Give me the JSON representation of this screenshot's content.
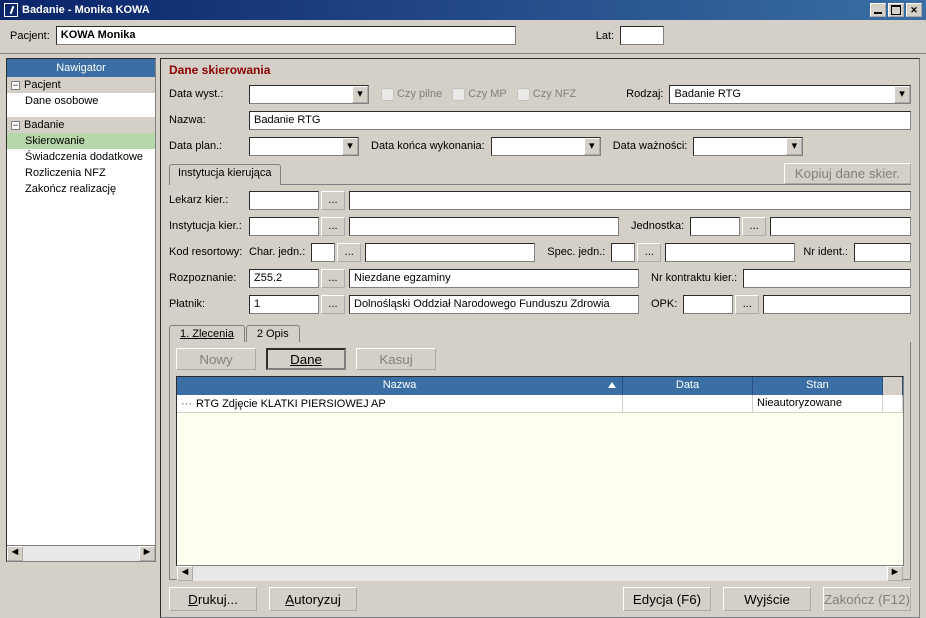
{
  "window": {
    "title": "Badanie - Monika KOWA"
  },
  "topbar": {
    "pacjent_label": "Pacjent:",
    "pacjent_value": "KOWA Monika",
    "lat_label": "Lat:",
    "lat_value": ""
  },
  "nav": {
    "header": "Nawigator",
    "pacjent": "Pacjent",
    "dane_osobowe": "Dane osobowe",
    "badanie": "Badanie",
    "skierowanie": "Skierowanie",
    "swiadczenia": "Świadczenia dodatkowe",
    "rozliczenia": "Rozliczenia NFZ",
    "zakoncz": "Zakończ realizację"
  },
  "section": {
    "title": "Dane skierowania"
  },
  "labels": {
    "data_wyst": "Data wyst.:",
    "czy_pilne": "Czy pilne",
    "czy_mp": "Czy MP",
    "czy_nfz": "Czy NFZ",
    "rodzaj": "Rodzaj:",
    "nazwa": "Nazwa:",
    "data_plan": "Data plan.:",
    "data_konca": "Data końca wykonania:",
    "data_waznosci": "Data ważności:",
    "instytucja_tab": "Instytucja kierująca",
    "kopiuj": "Kopiuj dane skier.",
    "lekarz": "Lekarz kier.:",
    "instytucja": "Instytucja kier.:",
    "jednostka": "Jednostka:",
    "kod_resortowy": "Kod resortowy:",
    "char_jedn": "Char. jedn.:",
    "spec_jedn": "Spec. jedn.:",
    "nr_ident": "Nr ident.:",
    "rozpoznanie": "Rozpoznanie:",
    "nr_kontraktu": "Nr kontraktu kier.:",
    "platnik": "Płatnik:",
    "opk": "OPK:"
  },
  "values": {
    "rodzaj": "Badanie RTG",
    "nazwa": "Badanie RTG",
    "rozpoznanie_kod": "Z55.2",
    "rozpoznanie_opis": "Niezdane egzaminy",
    "platnik_kod": "1",
    "platnik_opis": "Dolnośląski Oddział Narodowego Funduszu Zdrowia"
  },
  "tabs": {
    "zlecenia": "1. Zlecenia",
    "opis": "2 Opis"
  },
  "toolbar": {
    "nowy": "Nowy",
    "dane": "Dane",
    "kasuj": "Kasuj"
  },
  "grid": {
    "col_nazwa": "Nazwa",
    "col_data": "Data",
    "col_stan": "Stan",
    "row1_nazwa": "RTG Zdjęcie KLATKI PIERSIOWEJ AP",
    "row1_data": "",
    "row1_stan": "Nieautoryzowane"
  },
  "bottom": {
    "drukuj": "Drukuj...",
    "autoryzuj": "Autoryzuj",
    "edycja": "Edycja (F6)",
    "wyjscie": "Wyjście",
    "zakoncz": "Zakończ (F12)"
  }
}
